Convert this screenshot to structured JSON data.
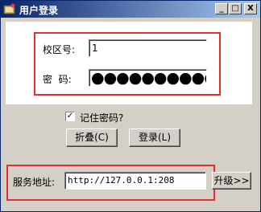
{
  "window": {
    "title": "用户登录"
  },
  "titlebar_buttons": {
    "minimize": "_",
    "maximize": "□",
    "close": "X"
  },
  "login": {
    "school_label": "校区号:",
    "school_value": "1",
    "password_label": "密  码:",
    "password_value": "●●●●●●●●●●"
  },
  "remember": {
    "label": "记住密码?",
    "checked": true,
    "mark": "✓"
  },
  "buttons": {
    "collapse": "折叠(C)",
    "login": "登录(L)"
  },
  "server": {
    "label": "服务地址:",
    "value": "http://127.0.0.1:208",
    "upgrade": "升级>>"
  }
}
